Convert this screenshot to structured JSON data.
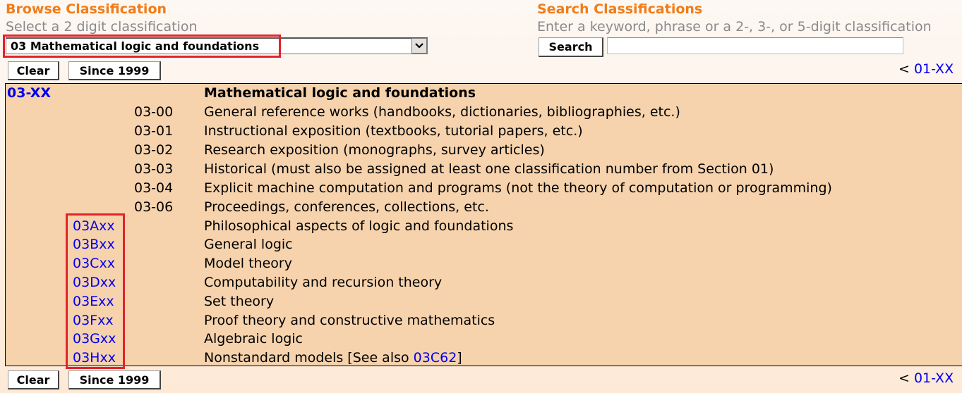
{
  "browse": {
    "title": "Browse Classification",
    "hint": "Select a 2 digit classification",
    "selected_value": "03 Mathematical logic and foundations",
    "clear_label": "Clear",
    "since_label": "Since 1999"
  },
  "search": {
    "title": "Search Classifications",
    "hint": "Enter a keyword, phrase or a 2-, 3-, or 5-digit classification",
    "button_label": "Search",
    "input_value": "",
    "input_placeholder": ""
  },
  "nav": {
    "prev_arrow": "<",
    "prev_link": "01-XX"
  },
  "highlight_color": "#e3232a",
  "table": {
    "top_code": "03-XX",
    "top_title": "Mathematical logic and foundations",
    "general_rows": [
      {
        "code": "03-00",
        "desc": "General reference works (handbooks, dictionaries, bibliographies, etc.)"
      },
      {
        "code": "03-01",
        "desc": "Instructional exposition (textbooks, tutorial papers, etc.)"
      },
      {
        "code": "03-02",
        "desc": "Research exposition (monographs, survey articles)"
      },
      {
        "code": "03-03",
        "desc": "Historical (must also be assigned at least one classification number from Section 01)"
      },
      {
        "code": "03-04",
        "desc": "Explicit machine computation and programs (not the theory of computation or programming)"
      },
      {
        "code": "03-06",
        "desc": "Proceedings, conferences, collections, etc."
      }
    ],
    "sub_rows": [
      {
        "code": "03Axx",
        "desc": "Philosophical aspects of logic and foundations"
      },
      {
        "code": "03Bxx",
        "desc": "General logic"
      },
      {
        "code": "03Cxx",
        "desc": "Model theory"
      },
      {
        "code": "03Dxx",
        "desc": "Computability and recursion theory"
      },
      {
        "code": "03Exx",
        "desc": "Set theory"
      },
      {
        "code": "03Fxx",
        "desc": "Proof theory and constructive mathematics"
      },
      {
        "code": "03Gxx",
        "desc": "Algebraic logic"
      },
      {
        "code": "03Hxx",
        "desc": "Nonstandard models [See also ",
        "see_also_link": "03C62",
        "desc_suffix": "]"
      }
    ]
  }
}
